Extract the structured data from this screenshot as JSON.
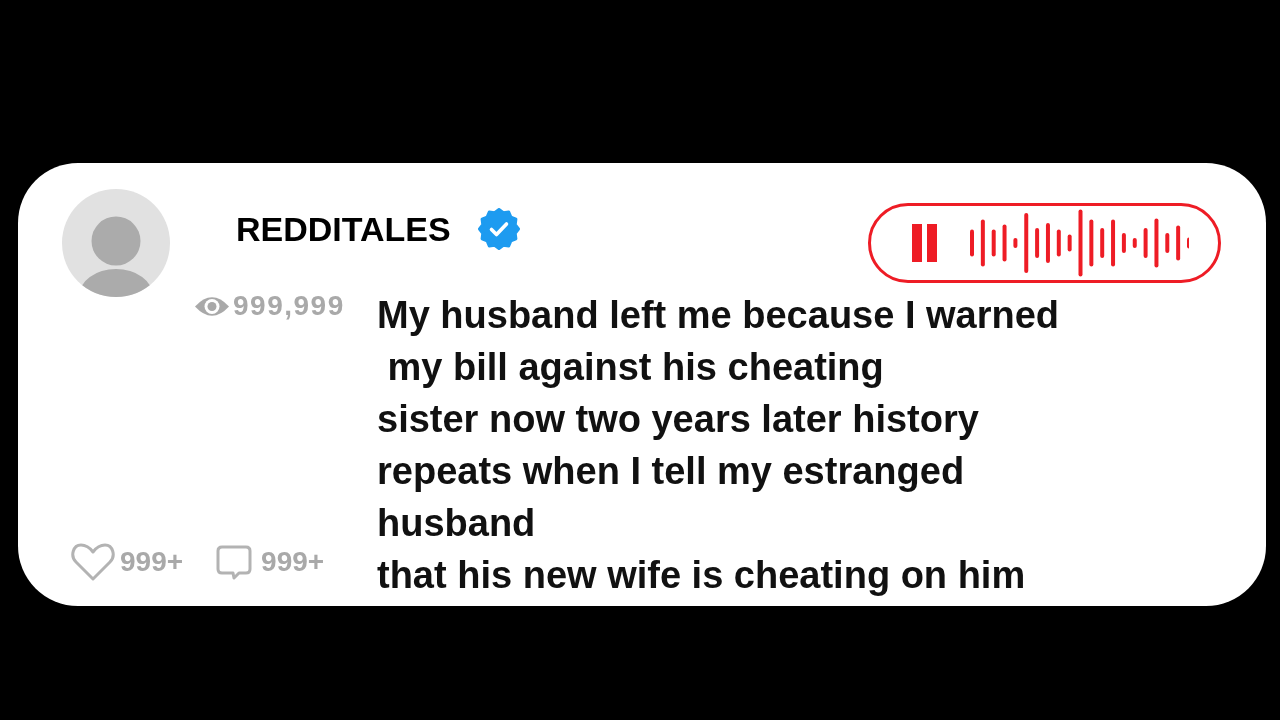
{
  "author": {
    "name": "REDDITALES",
    "verified": true
  },
  "player": {
    "playing": true
  },
  "stats": {
    "views": "999,999",
    "likes": "999+",
    "comments": "999+"
  },
  "post": {
    "lines": [
      "My husband left me because I warned",
      " my bill against his cheating",
      "sister now two years later history",
      "repeats when I tell my estranged",
      "husband",
      "that his new wife is cheating on him"
    ]
  }
}
